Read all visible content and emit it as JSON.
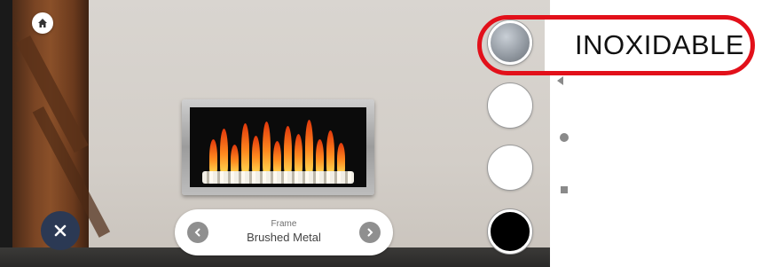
{
  "selector": {
    "label": "Frame",
    "value": "Brushed Metal"
  },
  "callout": {
    "text": "INOXIDABLE",
    "color": "#e2101a"
  },
  "swatches": [
    {
      "name": "brushed-metal",
      "color": "#9aa1a8",
      "selected": true
    },
    {
      "name": "white-1",
      "color": "#ffffff",
      "selected": false
    },
    {
      "name": "white-2",
      "color": "#ffffff",
      "selected": false
    },
    {
      "name": "black",
      "color": "#000000",
      "selected": false
    }
  ],
  "icons": {
    "home": "home-icon",
    "close": "close-icon",
    "prev": "chevron-left-icon",
    "next": "chevron-right-icon"
  },
  "colors": {
    "close_button": "#2b3954",
    "highlight": "#e2101a"
  }
}
